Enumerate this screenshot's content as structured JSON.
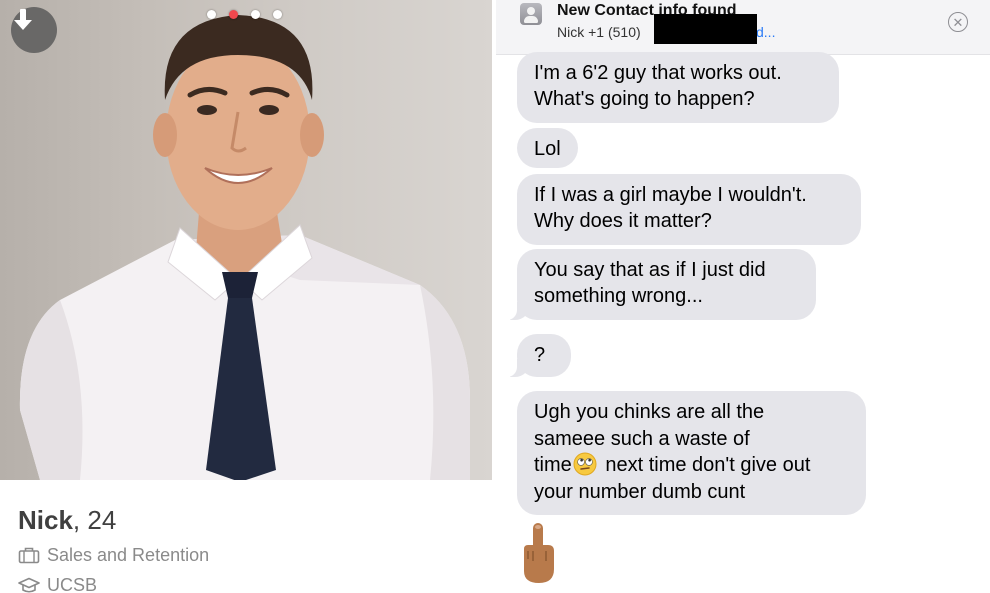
{
  "profile": {
    "name": "Nick",
    "age": ", 24",
    "job": "Sales and Retention",
    "school": "UCSB",
    "photo_count": 4,
    "active_photo": 2
  },
  "banner": {
    "title": "New Contact info found",
    "subtitle_prefix": "Nick +1 (510)",
    "subtitle_suffix": "d..."
  },
  "messages": [
    {
      "text_lines": [
        "I'm a 6'2 guy that works out.",
        "What's going to happen?"
      ]
    },
    {
      "text_lines": [
        "Lol"
      ]
    },
    {
      "text_lines": [
        "If I was a girl maybe I wouldn't.",
        "Why does it matter?"
      ]
    },
    {
      "text_lines": [
        "You say that as if I just did",
        "something wrong..."
      ]
    },
    {
      "text_lines": [
        "?"
      ]
    },
    {
      "line1": "Ugh you chinks are all the",
      "line2": "sameee such a waste of",
      "line3_before": "time",
      "line3_after": " next time don't give out",
      "line4": "your number dumb cunt"
    }
  ],
  "icons": {
    "download": "download-arrow-icon",
    "job": "briefcase-icon",
    "school": "graduation-cap-icon",
    "contact": "contact-card-icon",
    "close": "close-circle-icon",
    "eye_roll_emoji": "face-with-rolling-eyes-emoji",
    "middle_finger_emoji": "middle-finger-emoji"
  },
  "colors": {
    "active_dot": "#f0484d",
    "bubble_bg": "#e5e5ea",
    "link_blue": "#2a7bf6"
  }
}
